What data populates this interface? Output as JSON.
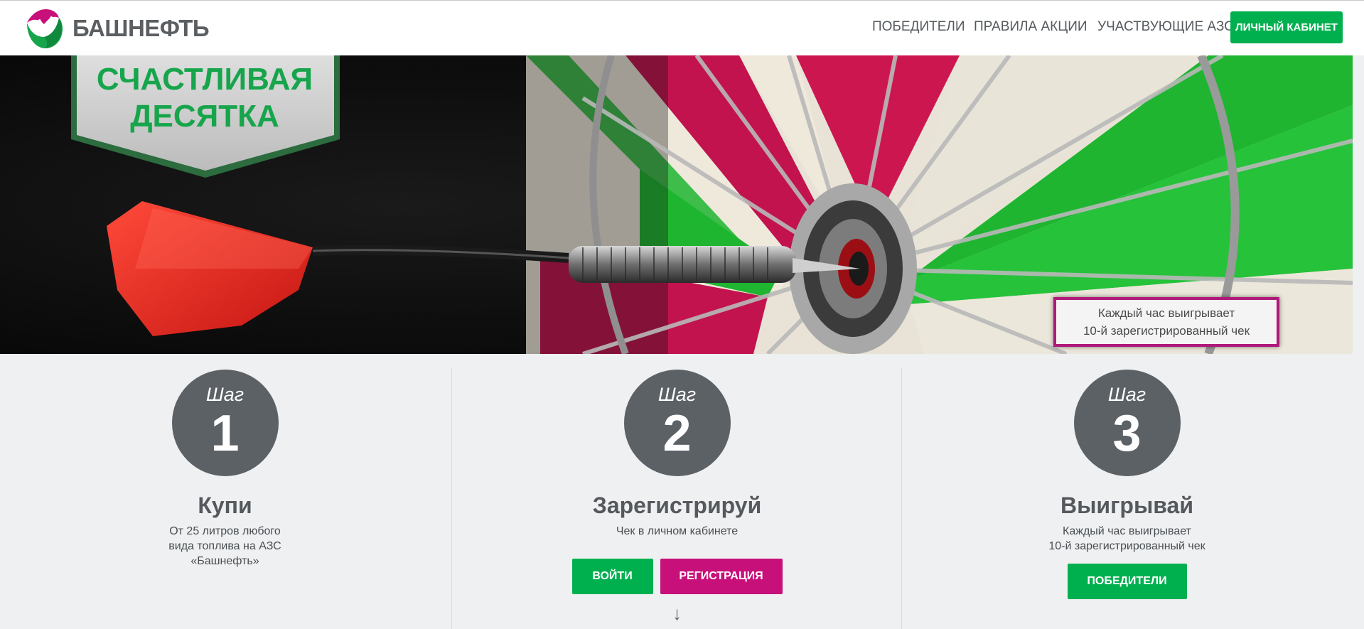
{
  "header": {
    "logo_text": "БАШНЕФТЬ",
    "nav": [
      "ПОБЕДИТЕЛИ",
      "ПРАВИЛА АКЦИИ",
      "УЧАСТВУЮЩИЕ АЗС"
    ],
    "cabinet_button": "ЛИЧНЫЙ КАБИНЕТ"
  },
  "banner": {
    "title_line1": "СЧАСТЛИВАЯ",
    "title_line2": "ДЕСЯТКА",
    "note_line1": "Каждый час выигрывает",
    "note_line2": "10-й зарегистрированный чек"
  },
  "steps": [
    {
      "prefix": "Шаг",
      "number": "1",
      "title": "Купи",
      "desc": "От 25 литров любого вида топлива на АЗС «Башнефть»"
    },
    {
      "prefix": "Шаг",
      "number": "2",
      "title": "Зарегистрируй",
      "desc": "Чек в личном кабинете",
      "buttons": [
        "ВОЙТИ",
        "РЕГИСТРАЦИЯ"
      ],
      "arrow": "↓"
    },
    {
      "prefix": "Шаг",
      "number": "3",
      "title": "Выигрывай",
      "desc_line1": "Каждый час выигрывает",
      "desc_line2": "10-й зарегистрированный чек",
      "button": "ПОБЕДИТЕЛИ"
    }
  ],
  "colors": {
    "brand_green": "#00b04f",
    "brand_pink": "#c7107a",
    "step_circle": "#5c6166",
    "page_bg": "#eef0f1"
  }
}
